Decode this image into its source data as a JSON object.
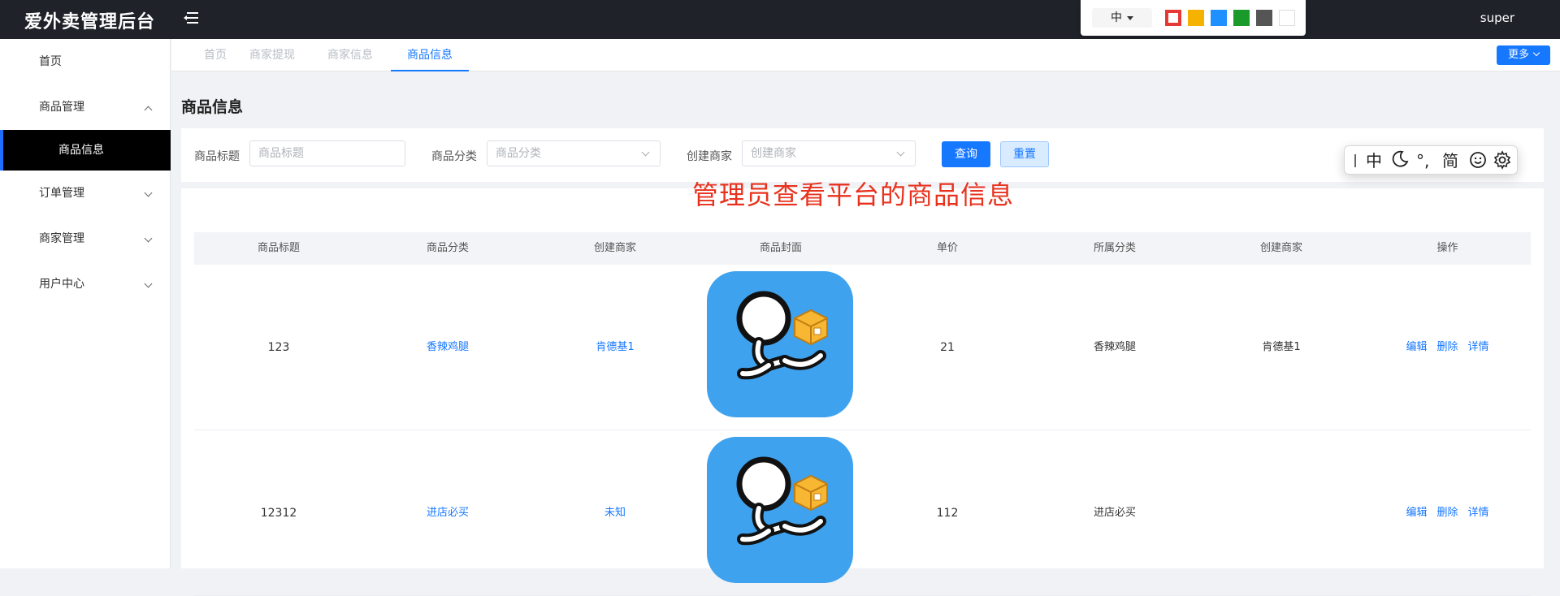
{
  "app": {
    "title": "爱外卖管理后台",
    "user": "super"
  },
  "toolbar": {
    "lang_label": "中"
  },
  "sidebar": {
    "items": [
      {
        "label": "首页"
      },
      {
        "label": "商品管理"
      },
      {
        "label": "商品信息"
      },
      {
        "label": "订单管理"
      },
      {
        "label": "商家管理"
      },
      {
        "label": "用户中心"
      }
    ]
  },
  "tabs": [
    {
      "label": "首页"
    },
    {
      "label": "商家提现"
    },
    {
      "label": "商家信息"
    },
    {
      "label": "商品信息"
    }
  ],
  "more_label": "更多",
  "page": {
    "title": "商品信息"
  },
  "filters": {
    "title_label": "商品标题",
    "title_placeholder": "商品标题",
    "category_label": "商品分类",
    "category_placeholder": "商品分类",
    "merchant_label": "创建商家",
    "merchant_placeholder": "创建商家",
    "query": "查询",
    "reset": "重置"
  },
  "caption": "管理员查看平台的商品信息",
  "ime": {
    "zh": "中",
    "simplified": "简"
  },
  "table": {
    "headers": [
      "商品标题",
      "商品分类",
      "创建商家",
      "商品封面",
      "单价",
      "所属分类",
      "创建商家",
      "操作"
    ],
    "rows": [
      {
        "title": "123",
        "category": "香辣鸡腿",
        "merchant": "肯德基1",
        "price": "21",
        "belong": "香辣鸡腿",
        "creator": "肯德基1"
      },
      {
        "title": "12312",
        "category": "进店必买",
        "merchant": "未知",
        "price": "112",
        "belong": "进店必买",
        "creator": ""
      }
    ],
    "ops": {
      "edit": "编辑",
      "delete": "删除",
      "detail": "详情"
    }
  },
  "colors": {
    "accent": "#1677ff",
    "topbar": "#1f2229",
    "caption": "#e8321e"
  }
}
